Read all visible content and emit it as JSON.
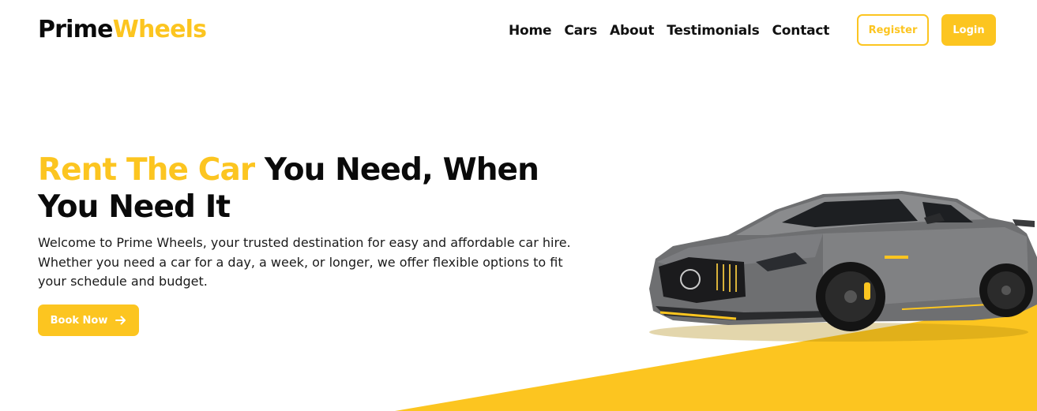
{
  "brand": {
    "name_part1": "Prime",
    "name_part2": "Wheels"
  },
  "nav": {
    "items": [
      {
        "label": "Home"
      },
      {
        "label": "Cars"
      },
      {
        "label": "About"
      },
      {
        "label": "Testimonials"
      },
      {
        "label": "Contact"
      }
    ]
  },
  "auth": {
    "register_label": "Register",
    "login_label": "Login"
  },
  "hero": {
    "title_accent": "Rent The Car",
    "title_rest": " You Need, When You Need It",
    "description": "Welcome to Prime Wheels, your trusted destination for easy and affordable car hire. Whether you need a car for a day, a week, or longer, we offer flexible options to fit your schedule and budget.",
    "cta_label": "Book Now",
    "cta_icon": "arrow-right-icon",
    "image": "sports-car-image"
  },
  "colors": {
    "accent": "#fcc520",
    "text": "#0a0a0a",
    "background": "#ffffff"
  }
}
